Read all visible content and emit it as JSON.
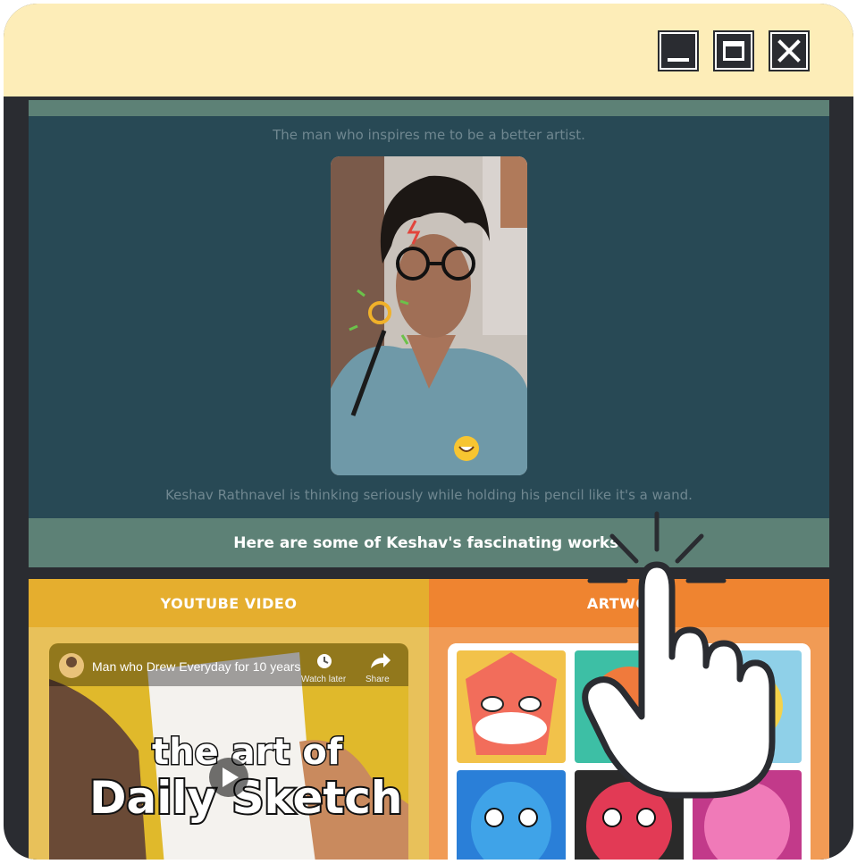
{
  "window": {
    "controls": [
      "minimize",
      "maximize",
      "close"
    ]
  },
  "profile": {
    "caption_top": "The man who inspires me to be a better artist.",
    "caption_bottom": "Keshav Rathnavel is thinking seriously while holding his pencil like it's a wand."
  },
  "banner": {
    "text": "Here are some of Keshav's fascinating works."
  },
  "columns": {
    "left_header": "YOUTUBE VIDEO",
    "right_header": "ARTWORK"
  },
  "video": {
    "title": "Man who Drew Everyday for 10 years",
    "watch_later": "Watch later",
    "share": "Share",
    "thumb_line1": "the art of",
    "thumb_line2": "Daily Sketch"
  },
  "colors": {
    "titlebar": "#fdedb8",
    "frame": "#2a2c31",
    "content_bg": "#284955",
    "banner": "#5d8176",
    "youtube_header": "#e5ae2e",
    "artwork_header": "#ef8430"
  },
  "icons": [
    "minimize-icon",
    "maximize-icon",
    "close-icon",
    "clock-icon",
    "share-icon",
    "play-icon",
    "pointer-hand-icon"
  ]
}
